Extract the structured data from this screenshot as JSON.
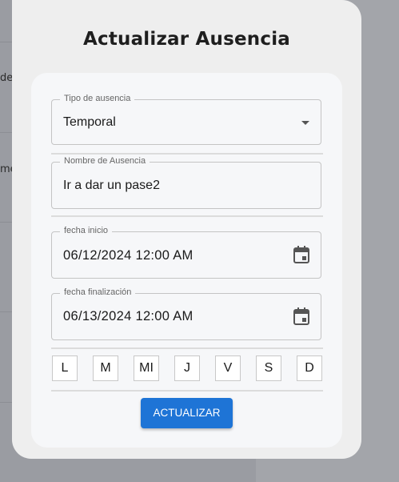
{
  "background": {
    "text_1": "de",
    "text_2": "me"
  },
  "modal": {
    "title": "Actualizar Ausencia"
  },
  "form": {
    "absence_type": {
      "label": "Tipo de ausencia",
      "value": "Temporal",
      "icon": "dropdown-caret-icon"
    },
    "absence_name": {
      "label": "Nombre de Ausencia",
      "value": "Ir a dar un pase2"
    },
    "start_date": {
      "label": "fecha inicio",
      "value": "06/12/2024 12:00 AM",
      "icon": "calendar-icon"
    },
    "end_date": {
      "label": "fecha finalización",
      "value": "06/13/2024 12:00 AM",
      "icon": "calendar-icon"
    },
    "days": [
      "L",
      "M",
      "MI",
      "J",
      "V",
      "S",
      "D"
    ],
    "submit_label": "ACTUALIZAR"
  },
  "colors": {
    "accent": "#1e74d6",
    "overlay": "#9ea0a6",
    "modal_bg": "#eeeeee",
    "card_bg": "#f6f7f9"
  }
}
